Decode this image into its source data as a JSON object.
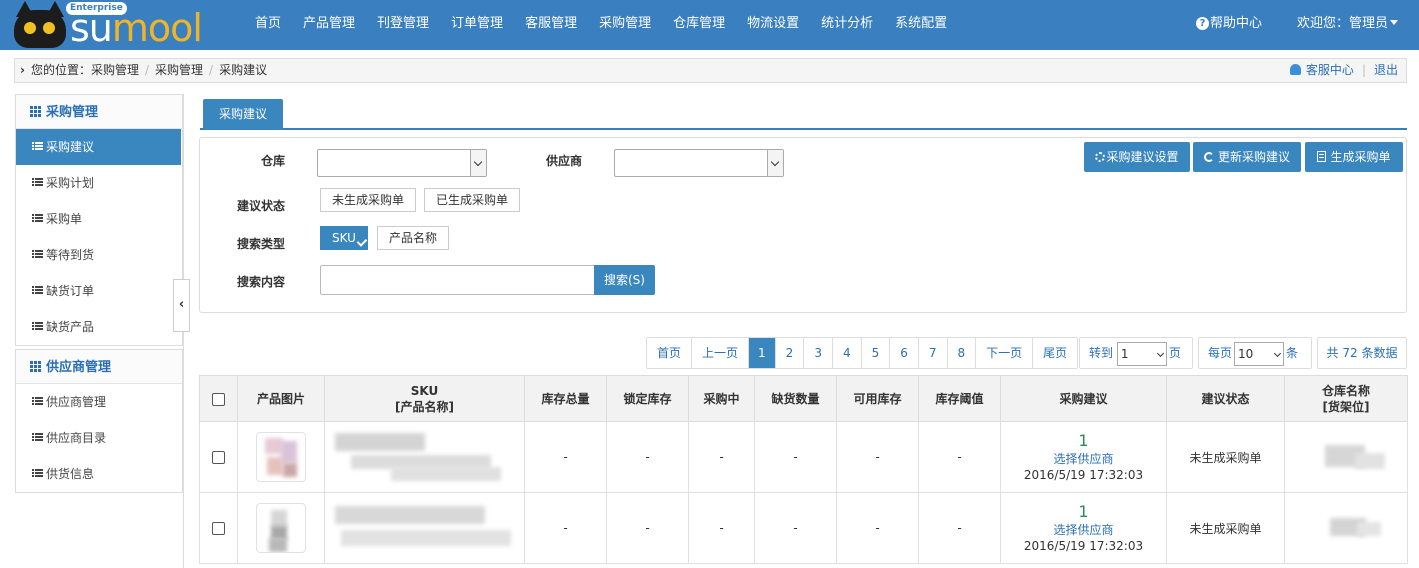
{
  "logo": {
    "badge": "Enterprise",
    "text_su": "su",
    "text_mool": "mool"
  },
  "nav": [
    "首页",
    "产品管理",
    "刊登管理",
    "订单管理",
    "客服管理",
    "采购管理",
    "仓库管理",
    "物流设置",
    "统计分析",
    "系统配置"
  ],
  "header": {
    "help": "帮助中心",
    "welcome": "欢迎您：管理员"
  },
  "breadcrumb": {
    "prefix": "您的位置：",
    "items": [
      "采购管理",
      "采购管理",
      "采购建议"
    ],
    "service": "客服中心",
    "logout": "退出"
  },
  "sidebar": {
    "group1": {
      "title": "采购管理",
      "items": [
        "采购建议",
        "采购计划",
        "采购单",
        "等待到货",
        "缺货订单",
        "缺货产品"
      ]
    },
    "group2": {
      "title": "供应商管理",
      "items": [
        "供应商管理",
        "供应商目录",
        "供货信息"
      ]
    }
  },
  "tab": "采购建议",
  "filter": {
    "warehouse_label": "仓库",
    "supplier_label": "供应商",
    "status_label": "建议状态",
    "status_options": [
      "未生成采购单",
      "已生成采购单"
    ],
    "search_type_label": "搜索类型",
    "search_type_options": [
      "SKU",
      "产品名称"
    ],
    "search_content_label": "搜索内容",
    "search_button": "搜索(S)",
    "settings_button": "采购建议设置",
    "refresh_button": "更新采购建议",
    "generate_button": "生成采购单"
  },
  "pager": {
    "first": "首页",
    "prev": "上一页",
    "pages": [
      "1",
      "2",
      "3",
      "4",
      "5",
      "6",
      "7",
      "8"
    ],
    "current": "1",
    "next": "下一页",
    "last": "尾页",
    "goto_label": "转到",
    "goto_value": "1",
    "page_unit": "页",
    "per_page_label": "每页",
    "per_page_value": "10",
    "per_page_unit": "条",
    "total": "共 72 条数据"
  },
  "table": {
    "headers": [
      "产品图片",
      "SKU",
      "[产品名称]",
      "库存总量",
      "锁定库存",
      "采购中",
      "缺货数量",
      "可用库存",
      "库存阈值",
      "采购建议",
      "建议状态",
      "仓库名称",
      "[货架位]"
    ],
    "rows": [
      {
        "stock": "-",
        "locked": "-",
        "purchasing": "-",
        "shortage": "-",
        "available": "-",
        "threshold": "-",
        "suggest_qty": "1",
        "supplier_link": "选择供应商",
        "time": "2016/5/19 17:32:03",
        "status": "未生成采购单"
      },
      {
        "stock": "-",
        "locked": "-",
        "purchasing": "-",
        "shortage": "-",
        "available": "-",
        "threshold": "-",
        "suggest_qty": "1",
        "supplier_link": "选择供应商",
        "time": "2016/5/19 17:32:03",
        "status": "未生成采购单"
      }
    ]
  },
  "colors": {
    "primary": "#3a7fbf",
    "active": "#3a87c0",
    "link": "#2a6fb5",
    "qty": "#2e8b57"
  }
}
